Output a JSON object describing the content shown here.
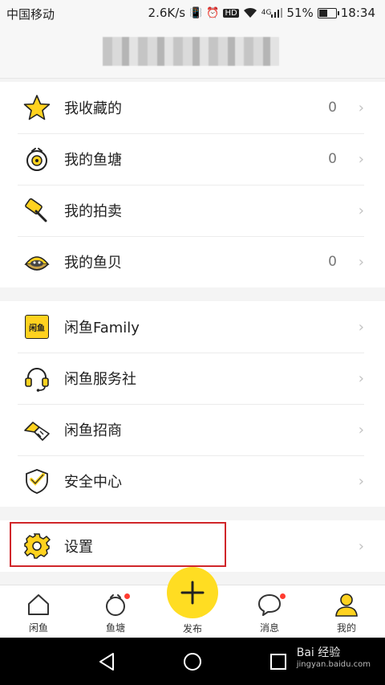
{
  "status_bar": {
    "carrier": "中国移动",
    "speed": "2.6K/s",
    "hd": "HD",
    "network": "4G",
    "battery": "51%",
    "time": "18:34"
  },
  "groups": {
    "g1": [
      {
        "label": "我收藏的",
        "count": "0",
        "icon": "star-icon"
      },
      {
        "label": "我的鱼塘",
        "count": "0",
        "icon": "pond-icon"
      },
      {
        "label": "我的拍卖",
        "count": "",
        "icon": "auction-hammer-icon"
      },
      {
        "label": "我的鱼贝",
        "count": "0",
        "icon": "shell-icon"
      }
    ],
    "g2": [
      {
        "label": "闲鱼Family",
        "icon": "family-badge-icon"
      },
      {
        "label": "闲鱼服务社",
        "icon": "headset-icon"
      },
      {
        "label": "闲鱼招商",
        "icon": "handshake-icon"
      },
      {
        "label": "安全中心",
        "icon": "shield-icon"
      }
    ],
    "g3": [
      {
        "label": "设置",
        "icon": "gear-icon"
      }
    ]
  },
  "family_badge_text": "闲鱼",
  "chevron": "›",
  "tabs": [
    {
      "label": "闲鱼",
      "icon": "home-icon"
    },
    {
      "label": "鱼塘",
      "icon": "pond-tab-icon"
    },
    {
      "label": "发布",
      "icon": "plus-icon"
    },
    {
      "label": "消息",
      "icon": "message-icon"
    },
    {
      "label": "我的",
      "icon": "profile-icon"
    }
  ],
  "colors": {
    "accent_yellow": "#ffdd22",
    "highlight_red": "#d0262a",
    "badge_red": "#ff3b30"
  },
  "watermark": {
    "brand": "Bai 经验",
    "url": "jingyan.baidu.com"
  }
}
